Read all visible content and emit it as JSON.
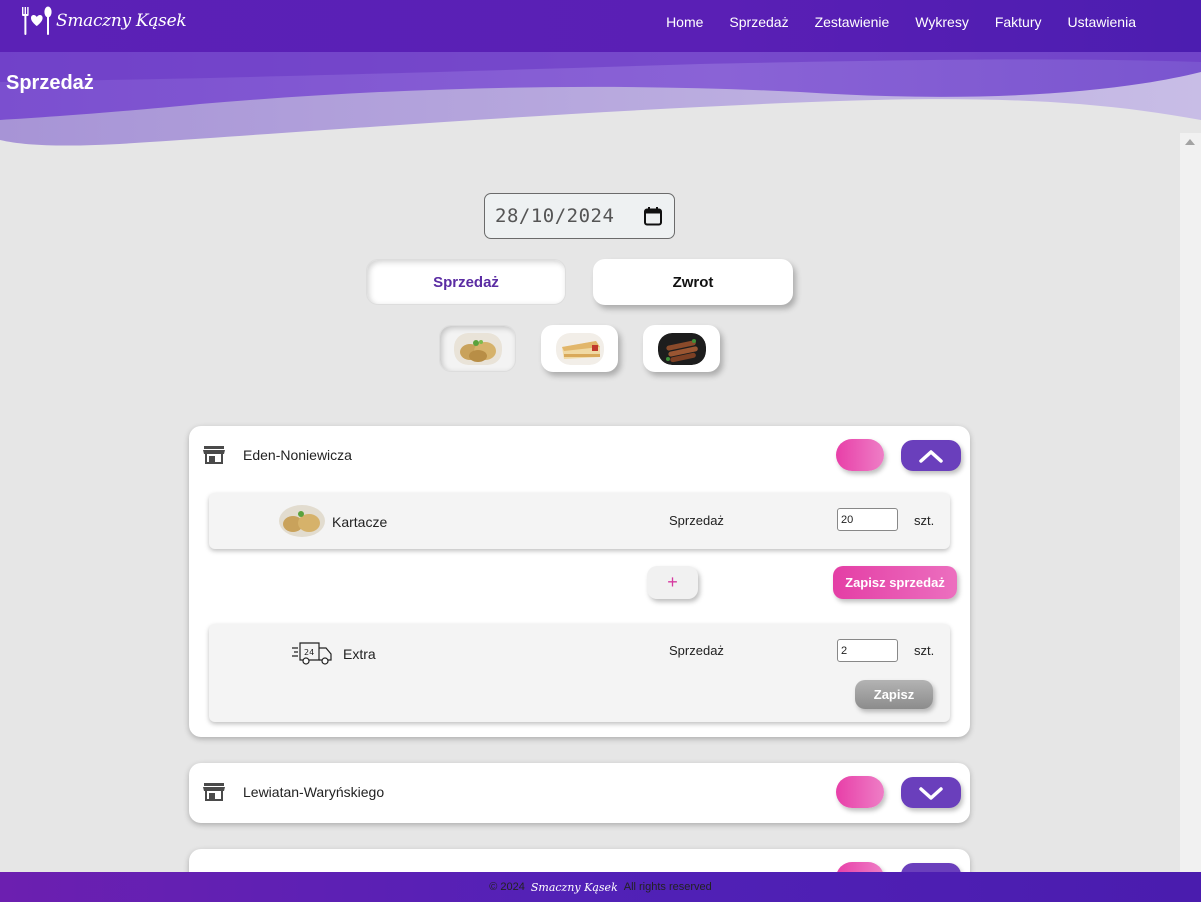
{
  "brand": {
    "name": "Smaczny Kąsek"
  },
  "nav": {
    "items": [
      {
        "label": "Home"
      },
      {
        "label": "Sprzedaż"
      },
      {
        "label": "Zestawienie"
      },
      {
        "label": "Wykresy"
      },
      {
        "label": "Faktury"
      },
      {
        "label": "Ustawienia"
      }
    ]
  },
  "page": {
    "title": "Sprzedaż"
  },
  "date": {
    "value": "28/10/2024"
  },
  "mode": {
    "sale_label": "Sprzedaż",
    "return_label": "Zwrot",
    "selected": "sale"
  },
  "products": [
    {
      "name": "kartacze-thumbnail",
      "selected": true
    },
    {
      "name": "cake-thumbnail",
      "selected": false
    },
    {
      "name": "sausages-thumbnail",
      "selected": false
    }
  ],
  "stores": [
    {
      "name": "Eden-Noniewicza",
      "expanded": true,
      "item": {
        "name": "Kartacze",
        "type": "Sprzedaż",
        "quantity": "20",
        "unit": "szt."
      },
      "add_label": "+",
      "save_sale_label": "Zapisz sprzedaż",
      "extra": {
        "name": "Extra",
        "type": "Sprzedaż",
        "quantity": "2",
        "unit": "szt.",
        "save_label": "Zapisz"
      }
    },
    {
      "name": "Lewiatan-Waryńskiego",
      "expanded": false
    }
  ],
  "footer": {
    "prefix": "© 2024",
    "brand": "Smaczny Kąsek",
    "suffix": "All rights reserved"
  },
  "colors": {
    "nav": "#5b21b6",
    "accent_pink": "#e83fa8",
    "accent_purple": "#6a3fbc",
    "background": "#e6e6e6"
  }
}
